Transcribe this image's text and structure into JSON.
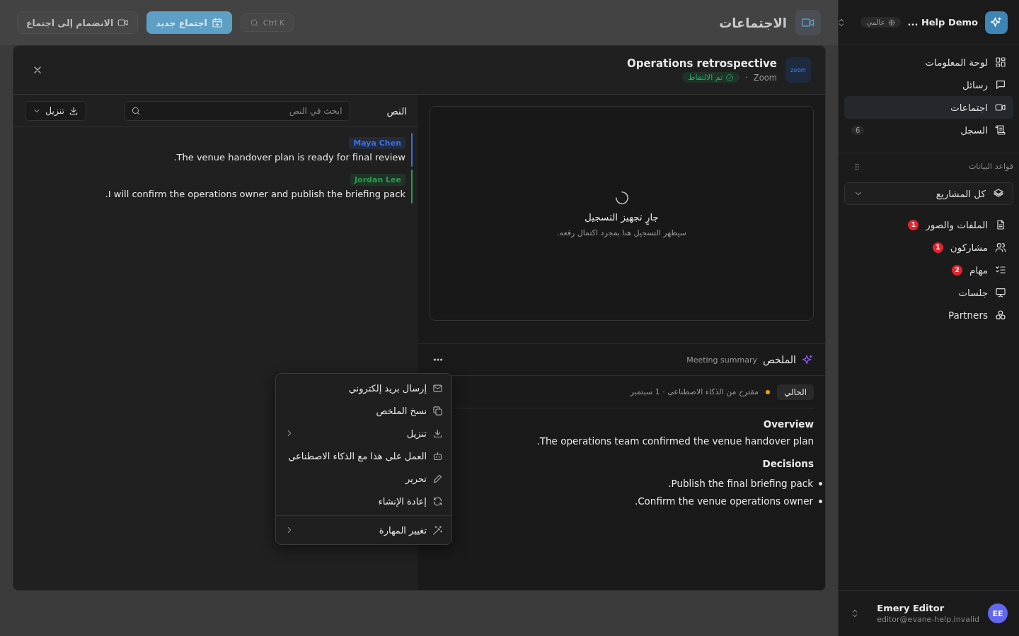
{
  "sidebar": {
    "workspace": {
      "name": "Help Demo ...",
      "scope": "عالمي"
    },
    "nav": [
      {
        "label": "لوحة المعلومات",
        "selected": false
      },
      {
        "label": "رسائل",
        "selected": false
      },
      {
        "label": "اجتماعات",
        "selected": true
      },
      {
        "label": "السجل",
        "selected": false,
        "count": "6"
      }
    ],
    "databases": {
      "title": "قواعد البيانات",
      "filter": "كل المشاريع",
      "items": [
        {
          "label": "الملفات والصور",
          "badge": "1"
        },
        {
          "label": "مشاركون",
          "badge": "1"
        },
        {
          "label": "مهام",
          "badge": "2"
        },
        {
          "label": "جلسات"
        },
        {
          "label": "Partners"
        }
      ]
    },
    "user": {
      "initials": "EE",
      "name": "Emery Editor",
      "email": "editor@evane-help.invalid"
    }
  },
  "header": {
    "title": "الاجتماعات",
    "search_shortcut": "Ctrl K",
    "buttons": [
      {
        "label": "اجتماع جديد",
        "kind": "primary"
      },
      {
        "label": "الانضمام إلى اجتماع",
        "kind": "secondary"
      }
    ]
  },
  "meeting": {
    "platform_logo": "zoom",
    "title": "Operations retrospective",
    "platform": "Zoom",
    "separator": "·",
    "status": "تم الالتقاط",
    "recording": {
      "title": "جارٍ تجهيز التسجيل",
      "message": "سيظهر التسجيل هنا بمجرد اكتمال رفعه."
    },
    "summary": {
      "title": "الملخص",
      "subtitle": "Meeting summary",
      "version": "الحالي",
      "source": "مقترح من الذكاء الاصطناعي · 1 سبتمبر",
      "sections": [
        {
          "heading": "Overview",
          "kind": "paragraph",
          "text": "The operations team confirmed the venue handover plan."
        },
        {
          "heading": "Decisions",
          "kind": "bullets",
          "items": [
            "Publish the final briefing pack.",
            "Confirm the venue operations owner."
          ]
        }
      ]
    },
    "transcript": {
      "title": "النص",
      "search_placeholder": "ابحث في النص",
      "download": "تنزيل",
      "entries": [
        {
          "speaker": "Maya Chen",
          "color": "#3b6fe0",
          "text": "The venue handover plan is ready for final review."
        },
        {
          "speaker": "Jordan Lee",
          "color": "#22a04b",
          "text": "I will confirm the operations owner and publish the briefing pack."
        }
      ]
    }
  },
  "menu": {
    "sections": [
      {
        "items": [
          {
            "label": "إرسال بريد إلكتروني",
            "submenu": false
          },
          {
            "label": "نسخ الملخص",
            "submenu": false
          },
          {
            "label": "تنزيل",
            "submenu": true
          },
          {
            "label": "العمل على هذا مع الذكاء الاصطناعي",
            "submenu": false
          },
          {
            "label": "تحرير",
            "submenu": false
          },
          {
            "label": "إعادة الإنشاء",
            "submenu": false
          }
        ]
      },
      {
        "items": [
          {
            "label": "تغيير المهارة",
            "submenu": true
          }
        ]
      }
    ]
  }
}
